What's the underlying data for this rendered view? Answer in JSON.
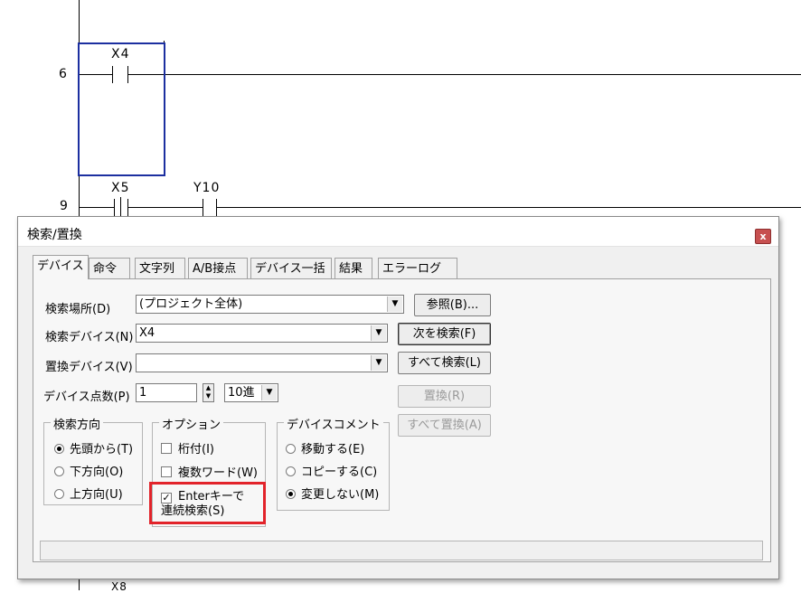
{
  "ladder": {
    "row1_number": "6",
    "row1_contact": "X4",
    "row2_number": "9",
    "row2_contact1": "X5",
    "row2_contact2": "Y10",
    "row3_contact": "X8"
  },
  "dialog": {
    "title": "検索/置換",
    "close_glyph": "x",
    "tabs": [
      {
        "label": "デバイス"
      },
      {
        "label": "命令"
      },
      {
        "label": "文字列"
      },
      {
        "label": "A/B接点"
      },
      {
        "label": "デバイス一括"
      },
      {
        "label": "結果"
      },
      {
        "label": "エラーログ"
      }
    ],
    "search_location_label": "検索場所(D)",
    "search_location_value": "(プロジェクト全体)",
    "search_device_label": "検索デバイス(N)",
    "search_device_value": "X4",
    "replace_device_label": "置換デバイス(V)",
    "replace_device_value": "",
    "device_count_label": "デバイス点数(P)",
    "device_count_value": "1",
    "radix_value": "10進",
    "buttons": {
      "browse": "参照(B)...",
      "find_next": "次を検索(F)",
      "find_all": "すべて検索(L)",
      "replace": "置換(R)",
      "replace_all": "すべて置換(A)"
    },
    "direction_group": {
      "title": "検索方向",
      "items": [
        "先頭から(T)",
        "下方向(O)",
        "上方向(U)"
      ],
      "selected": 0
    },
    "options_group": {
      "title": "オプション",
      "digit_label": "桁付(I)",
      "multiword_label": "複数ワード(W)",
      "enter_line1": "Enterキーで",
      "enter_line2": "連続検索(S)",
      "check_glyph": "✓"
    },
    "comment_group": {
      "title": "デバイスコメント",
      "items": [
        "移動する(E)",
        "コピーする(C)",
        "変更しない(M)"
      ],
      "selected": 2
    },
    "arrow_glyph": "▼",
    "spin_up": "▲",
    "spin_down": "▼"
  },
  "colors": {
    "highlight": "#e2232a",
    "selection": "#1c2fa0"
  }
}
